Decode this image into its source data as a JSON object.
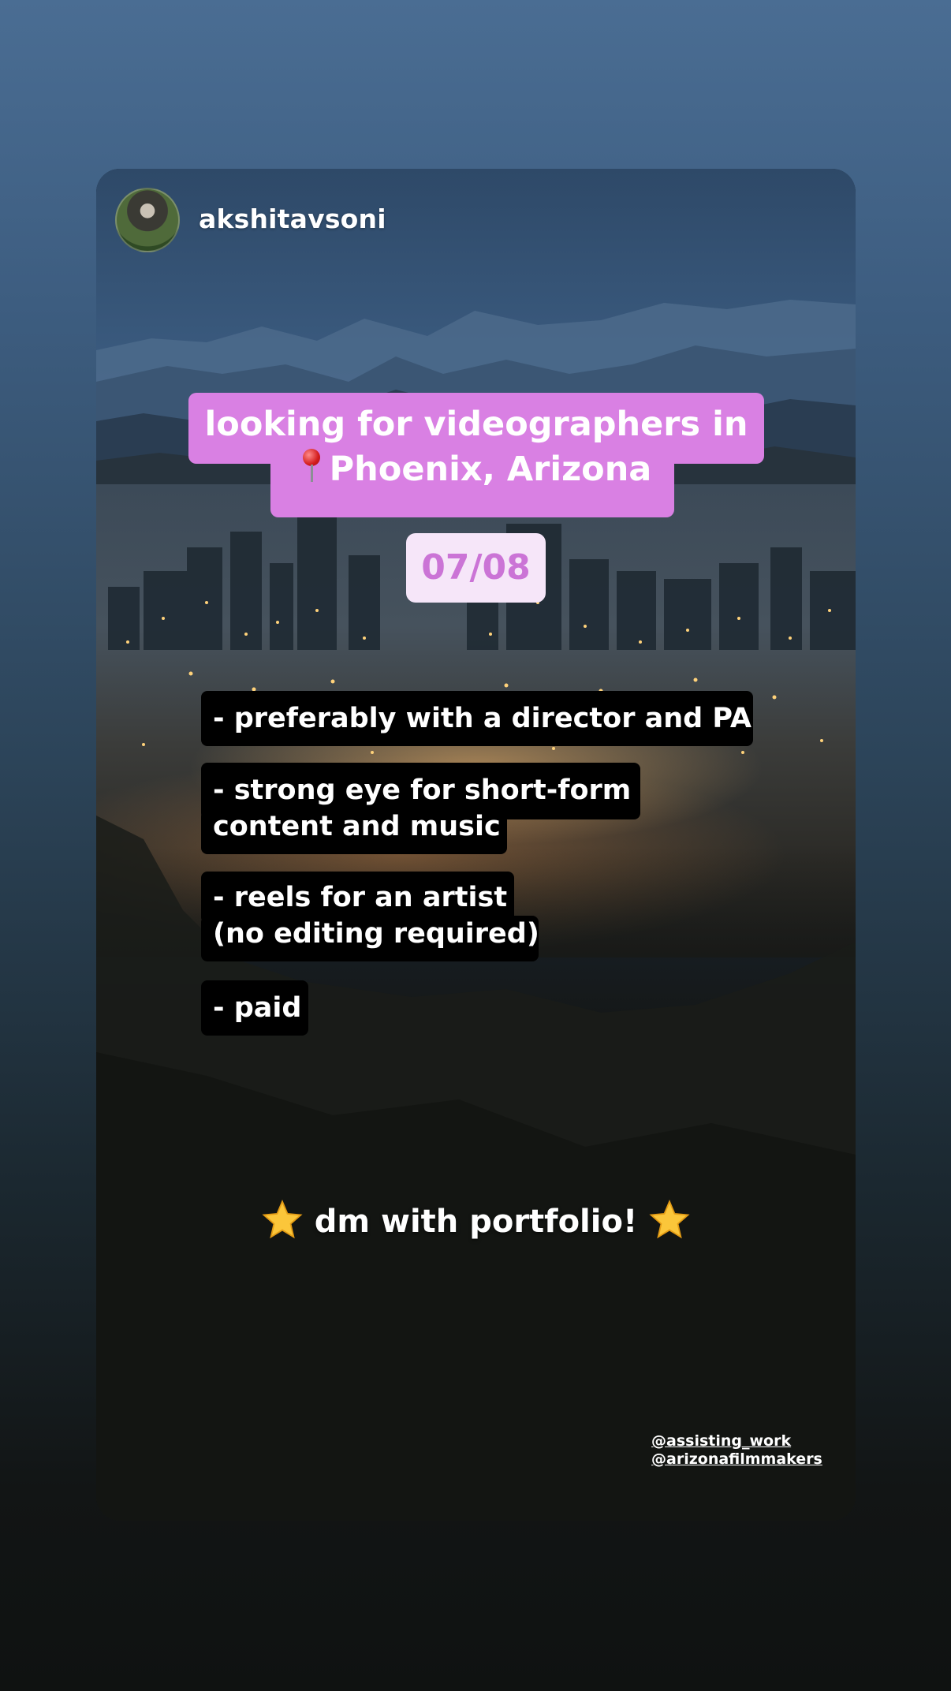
{
  "story": {
    "username": "akshitavsoni",
    "title_line1": "looking for videographers in",
    "title_line2": "Phoenix, Arizona",
    "location_icon": "pin-icon",
    "date": "07/08",
    "requirements": [
      {
        "line1": "- preferably with a director and PA"
      },
      {
        "line1": "- strong eye for short-form",
        "line2": "content and music"
      },
      {
        "line1": "- reels for an artist",
        "line2": "(no editing required)"
      },
      {
        "line1": "- paid"
      }
    ],
    "cta": "dm with portfolio!",
    "cta_icon": "star-icon",
    "mentions": [
      "@assisting_work",
      "@arizonafilmmakers"
    ]
  },
  "colors": {
    "title_pill": "#d980e3",
    "date_bg": "#f6e6f9",
    "date_text": "#cb74d6",
    "req_bg": "#000000"
  }
}
